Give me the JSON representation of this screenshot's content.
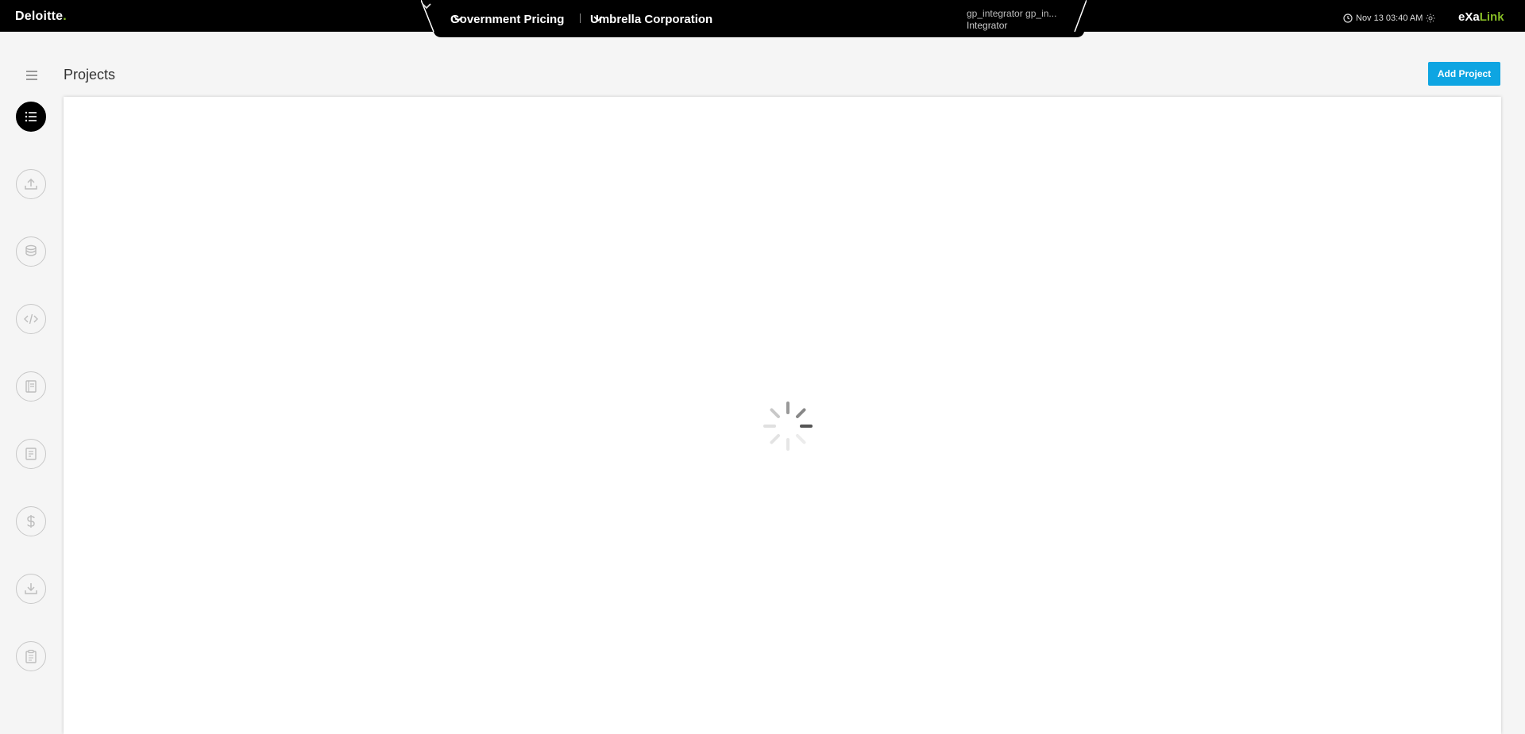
{
  "header": {
    "brand": "Deloitte",
    "brand_dot": ".",
    "module_selector": "Government Pricing",
    "company_selector": "Umbrella Corporation",
    "user_name": "gp_integrator gp_in...",
    "user_role": "Integrator",
    "datetime": "Nov 13 03:40 AM",
    "app_name_a": "eXa",
    "app_name_b": "Link"
  },
  "page": {
    "title": "Projects",
    "add_button": "Add Project",
    "loading": true
  },
  "sidebar": {
    "items": [
      {
        "icon": "list-icon",
        "active": true
      },
      {
        "icon": "upload-icon",
        "active": false
      },
      {
        "icon": "database-icon",
        "active": false
      },
      {
        "icon": "code-icon",
        "active": false
      },
      {
        "icon": "book-icon",
        "active": false
      },
      {
        "icon": "document-icon",
        "active": false
      },
      {
        "icon": "dollar-icon",
        "active": false
      },
      {
        "icon": "download-icon",
        "active": false
      },
      {
        "icon": "clipboard-icon",
        "active": false
      }
    ]
  },
  "colors": {
    "brand_green": "#86bc25",
    "primary_button": "#0ea5e2",
    "topbar": "#000000"
  }
}
